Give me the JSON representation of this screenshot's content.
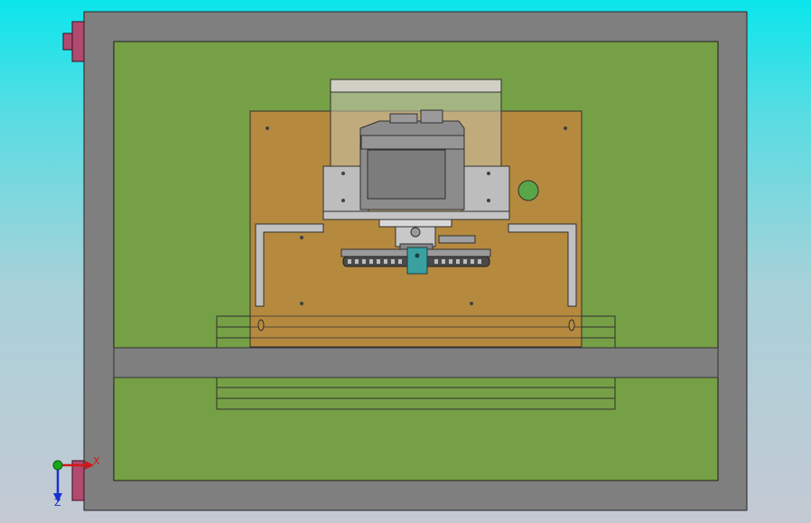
{
  "viewport": {
    "background_top": "#0ae6ec",
    "background_bottom": "#c4c9d4"
  },
  "model": {
    "frame_color": "#7f7f7f",
    "base_color": "#76a046",
    "plate_color": "#b58a3f",
    "glass_color": "#cfcfc4",
    "device_color": "#8c8c8c",
    "knob_color": "#5aa548",
    "bracket_color": "#c0c0c0",
    "mount_color": "#3aa0a0",
    "clamp_color": "#b24a70"
  },
  "triad": {
    "x_label": "X",
    "z_label": "Z",
    "x_color": "#d01818",
    "y_color": "#18a818",
    "z_color": "#1830d0",
    "x_icon": "x-axis-arrow-icon",
    "z_icon": "z-axis-arrow-icon",
    "origin_icon": "triad-origin-icon"
  }
}
